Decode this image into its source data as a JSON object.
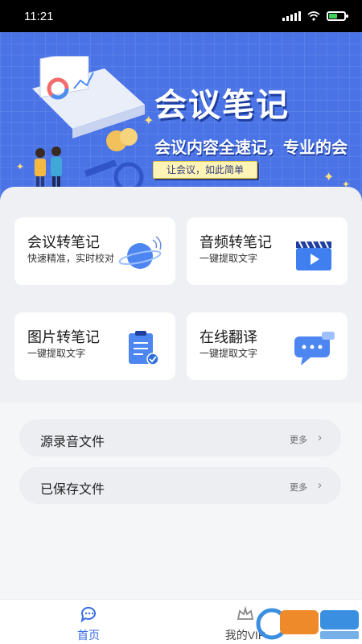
{
  "status_bar": {
    "time": "11:21",
    "battery_level": 0.55
  },
  "banner": {
    "title": "会议笔记",
    "subtitle": "会议内容全速记，专业的会议小助手",
    "tag": "让会议，如此简单"
  },
  "features": [
    {
      "title": "会议转笔记",
      "desc": "快速精准，实时校对",
      "icon": "planet-icon"
    },
    {
      "title": "音频转笔记",
      "desc": "一键提取文字",
      "icon": "video-clapper-icon"
    },
    {
      "title": "图片转笔记",
      "desc": "一键提取文字",
      "icon": "clipboard-check-icon"
    },
    {
      "title": "在线翻译",
      "desc": "一键提取文字",
      "icon": "chat-bubble-icon"
    }
  ],
  "files": [
    {
      "label": "源录音文件",
      "more": "更多"
    },
    {
      "label": "已保存文件",
      "more": "更多"
    }
  ],
  "tabs": [
    {
      "label": "首页",
      "active": true
    },
    {
      "label": "我的VIP",
      "active": false
    }
  ],
  "colors": {
    "accent": "#3a6de6",
    "banner": "#4a73e6"
  }
}
